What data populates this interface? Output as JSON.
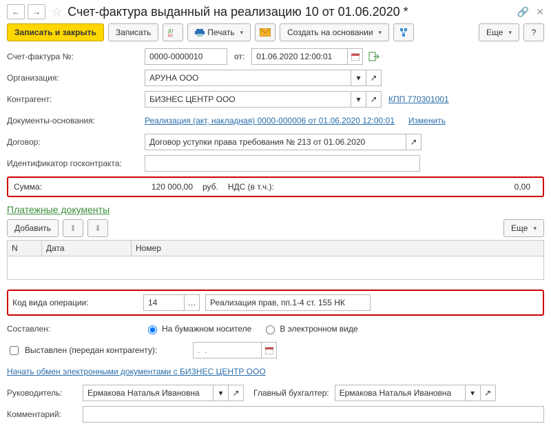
{
  "title": "Счет-фактура выданный на реализацию 10 от 01.06.2020 *",
  "toolbar": {
    "save_close": "Записать и закрыть",
    "save": "Записать",
    "print": "Печать",
    "base_create": "Создать на основании",
    "more": "Еще"
  },
  "fields": {
    "sf_no_label": "Счет-фактура №:",
    "sf_no": "0000-0000010",
    "from_label": "от:",
    "sf_date": "01.06.2020 12:00:01",
    "org_label": "Организация:",
    "org": "АРУНА ООО",
    "contr_label": "Контрагент:",
    "contr": "БИЗНЕС ЦЕНТР ООО",
    "contr_kpp": "КПП 770301001",
    "base_docs_label": "Документы-основания:",
    "base_docs_link": "Реализация (акт, накладная) 0000-000006 от 01.06.2020 12:00:01",
    "base_docs_edit": "Изменить",
    "contract_label": "Договор:",
    "contract": "Договор уступки права требования № 213 от 01.06.2020",
    "goscontract_label": "Идентификатор госконтракта:",
    "goscontract": ""
  },
  "sum": {
    "label": "Сумма:",
    "amount": "120 000,00",
    "currency": "руб.",
    "nds_label": "НДС (в т.ч.):",
    "nds": "0,00"
  },
  "paydocs": {
    "section": "Платежные документы",
    "add": "Добавить",
    "more": "Еще",
    "col_n": "N",
    "col_date": "Дата",
    "col_number": "Номер"
  },
  "opcode": {
    "label": "Код вида операции:",
    "code": "14",
    "desc": "Реализация прав, пп.1-4 ст. 155 НК"
  },
  "composed": {
    "label": "Составлен:",
    "opt_paper": "На бумажном носителе",
    "opt_electronic": "В электронном виде"
  },
  "issued": {
    "label": "Выставлен (передан контрагенту):",
    "date": ""
  },
  "edo_link": "Начать обмен электронными документами с БИЗНЕС ЦЕНТР ООО",
  "signers": {
    "head_label": "Руководитель:",
    "head": "Ермакова Наталья Ивановна",
    "accountant_label": "Главный бухгалтер:",
    "accountant": "Ермакова Наталья Ивановна"
  },
  "comment": {
    "label": "Комментарий:",
    "value": ""
  }
}
